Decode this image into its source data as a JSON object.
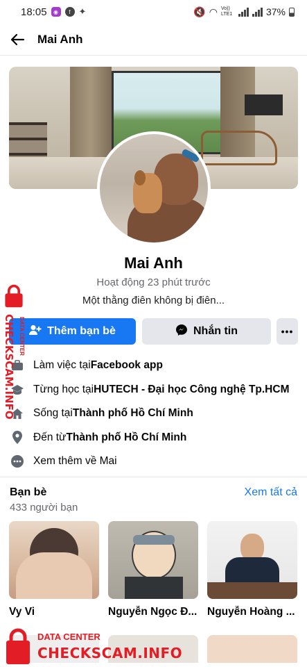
{
  "status": {
    "time": "18:05",
    "battery": "37%",
    "network": "Vo)) LTE1"
  },
  "topbar": {
    "title": "Mai Anh"
  },
  "profile": {
    "name": "Mai Anh",
    "active": "Hoạt động 23 phút trước",
    "bio": "Một thằng điên không bị điên..."
  },
  "actions": {
    "add_friend": "Thêm bạn bè",
    "message": "Nhắn tin",
    "more": "•••"
  },
  "info": [
    {
      "icon": "briefcase-icon",
      "prefix": "Làm việc tại ",
      "bold": "Facebook app"
    },
    {
      "icon": "graduation-cap-icon",
      "prefix": "Từng học tại ",
      "bold": "HUTECH - Đại học Công nghệ Tp.HCM"
    },
    {
      "icon": "home-icon",
      "prefix": "Sống tại ",
      "bold": "Thành phố Hồ Chí Minh"
    },
    {
      "icon": "location-pin-icon",
      "prefix": "Đến từ ",
      "bold": "Thành phố Hồ Chí Minh"
    },
    {
      "icon": "more-dots-icon",
      "prefix": "Xem thêm về Mai",
      "bold": ""
    }
  ],
  "friends": {
    "heading": "Bạn bè",
    "see_all": "Xem tất cả",
    "count": "433 người bạn",
    "list": [
      {
        "name": "Vy Vi"
      },
      {
        "name": "Nguyễn Ngọc Đ..."
      },
      {
        "name": "Nguyễn Hoàng ..."
      }
    ]
  },
  "watermark": {
    "data_center": "DATA CENTER",
    "brand": "CHECKSCAM.INFO"
  },
  "colors": {
    "accent": "#1877f2",
    "watermark": "#e21d25",
    "secondary_text": "#65676b",
    "button_gray": "#e4e6eb"
  }
}
